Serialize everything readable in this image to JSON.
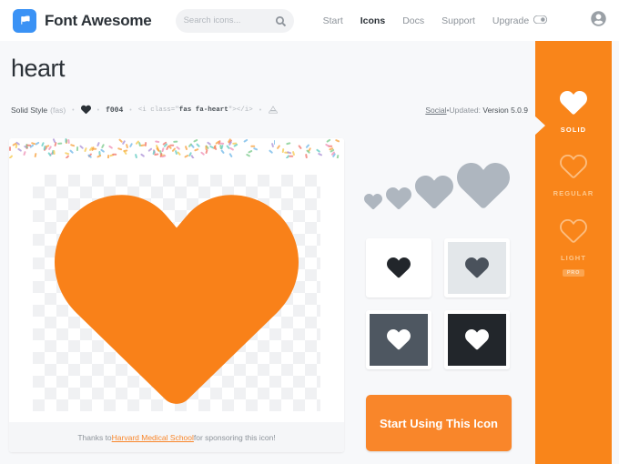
{
  "header": {
    "brand_name": "Font Awesome",
    "brand_logo_icon": "flag-icon",
    "search": {
      "placeholder": "Search icons...",
      "value": "",
      "icon": "search-icon"
    },
    "nav": [
      {
        "label": "Start",
        "active": false
      },
      {
        "label": "Icons",
        "active": true
      },
      {
        "label": "Docs",
        "active": false
      },
      {
        "label": "Support",
        "active": false
      },
      {
        "label": "Upgrade",
        "active": false,
        "icon": "toggle-on-icon"
      }
    ],
    "account_icon": "user-circle-icon"
  },
  "page": {
    "title": "heart",
    "meta": {
      "style_name": "Solid Style",
      "style_code": "(fas)",
      "glyph_icon": "heart-icon",
      "unicode": "f004",
      "code_prefix": "<i class=\"",
      "code_classes": "fas fa-heart",
      "code_suffix": "\"></i>",
      "download_icon": "download-icon",
      "separator": "•"
    },
    "meta_right": {
      "category": "Social",
      "separator": "•",
      "updated_label": "Updated:",
      "updated_version": "Version 5.0.9"
    }
  },
  "preview": {
    "icon": "heart-icon",
    "icon_color": "#F98119",
    "sponsor_prefix": "Thanks to ",
    "sponsor_link": "Harvard Medical School",
    "sponsor_suffix": " for sponsoring this icon!"
  },
  "sizes": {
    "icon": "heart-icon",
    "color": "#aeb6bf",
    "items": [
      {
        "size": 20
      },
      {
        "size": 28
      },
      {
        "size": 42
      },
      {
        "size": 58
      }
    ]
  },
  "swatches": [
    {
      "name": "light-on-white",
      "bg": "#ffffff",
      "fg": "#22262b"
    },
    {
      "name": "dark-on-light-gray",
      "bg": "#e3e7ea",
      "fg": "#4a525c"
    },
    {
      "name": "white-on-slate",
      "bg": "#4e5761",
      "fg": "#ffffff"
    },
    {
      "name": "white-on-dark",
      "bg": "#22262b",
      "fg": "#ffffff"
    }
  ],
  "cta": {
    "label": "Start Using This Icon"
  },
  "style_bar": {
    "accent": "#F9851A",
    "items": [
      {
        "label": "SOLID",
        "variant": "solid",
        "active": true,
        "pro": false
      },
      {
        "label": "REGULAR",
        "variant": "regular",
        "active": false,
        "pro": false
      },
      {
        "label": "LIGHT",
        "variant": "light",
        "active": false,
        "pro": true,
        "pro_label": "PRO"
      }
    ]
  }
}
